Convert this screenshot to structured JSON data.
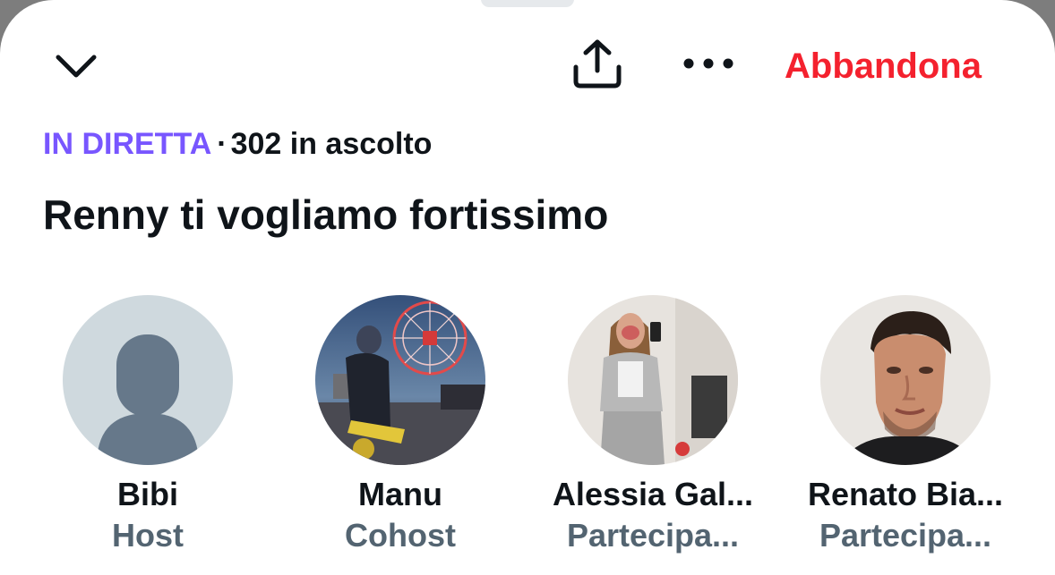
{
  "header": {
    "collapse_icon": "chevron-down-icon",
    "share_icon": "share-icon",
    "more_icon": "more-horizontal-icon",
    "leave_label": "Abbandona"
  },
  "space": {
    "live_label": "IN DIRETTA",
    "separator": "·",
    "listeners_text": "302 in ascolto",
    "title": "Renny ti vogliamo fortissimo"
  },
  "speakers": [
    {
      "name": "Bibi",
      "role": "Host"
    },
    {
      "name": "Manu",
      "role": "Cohost"
    },
    {
      "name": "Alessia Gal...",
      "role": "Partecipa..."
    },
    {
      "name": "Renato Bia...",
      "role": "Partecipa..."
    }
  ],
  "colors": {
    "live": "#7856ff",
    "leave": "#f4212e",
    "text_primary": "#0f1419",
    "text_secondary": "#536471"
  }
}
